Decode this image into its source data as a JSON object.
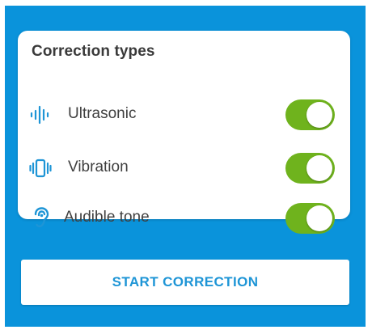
{
  "card": {
    "title": "Correction types"
  },
  "corrections": [
    {
      "label": "Ultrasonic",
      "icon": "ultrasonic-wave-icon",
      "enabled": true
    },
    {
      "label": "Vibration",
      "icon": "vibration-icon",
      "enabled": true
    },
    {
      "label": "Audible tone",
      "icon": "ear-icon",
      "enabled": true
    }
  ],
  "actions": {
    "start_label": "START CORRECTION"
  },
  "colors": {
    "background": "#0a93db",
    "toggle_on": "#6fb31d",
    "accent_text": "#1e95d6",
    "icon": "#1e95d6"
  }
}
